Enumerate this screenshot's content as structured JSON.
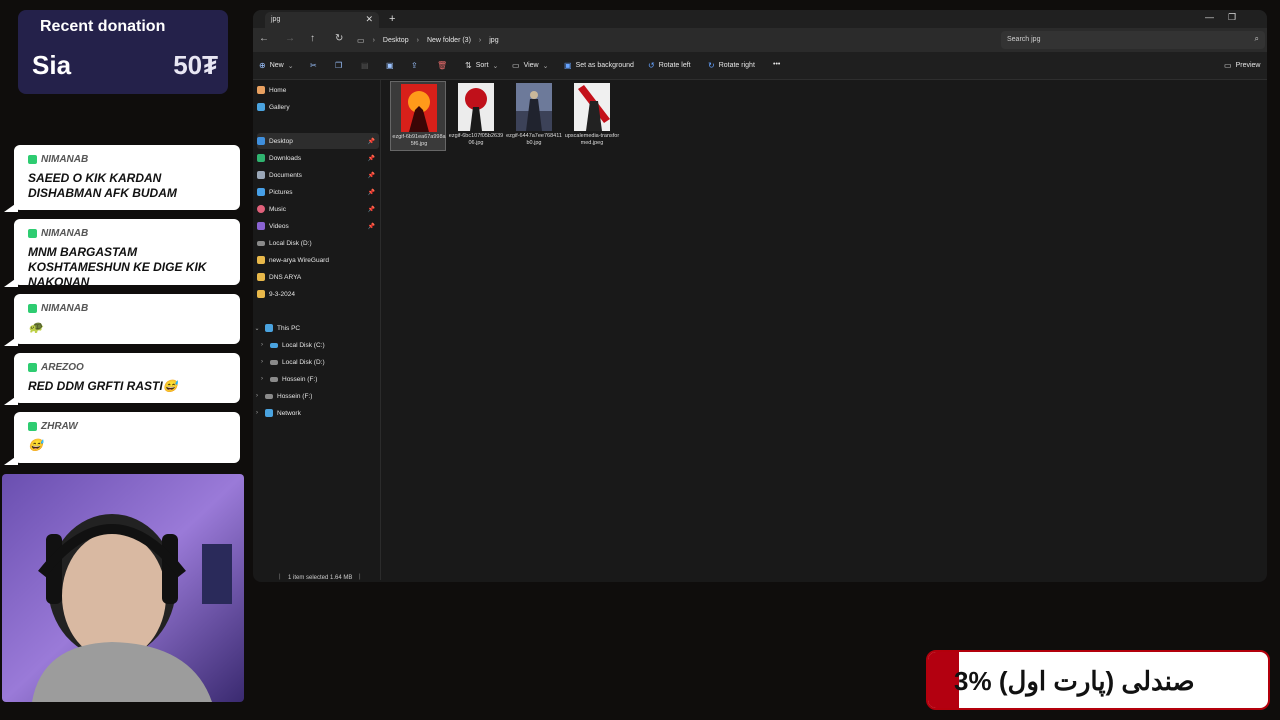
{
  "overlay": {
    "donation": {
      "title": "Recent donation",
      "name": "Sia",
      "amount": "50₮"
    },
    "chat": [
      {
        "user": "NIMANAB",
        "message": "SAEED O KIK KARDAN DISHABMAN AFK BUDAM"
      },
      {
        "user": "NIMANAB",
        "message": "MNM BARGASTAM KOSHTAMESHUN KE DIGE KIK NAKONAN"
      },
      {
        "user": "NIMANAB",
        "message": "🐢"
      },
      {
        "user": "AREZOO",
        "message": "RED DDM GRFTI RASTI😅"
      },
      {
        "user": "ZHRAW",
        "message": "😅"
      }
    ],
    "banner": {
      "progress": 0.09,
      "text": "3%  صندلی (پارت اول)",
      "bar_color": "#b30010"
    }
  },
  "explorer": {
    "tab_title": "jpg",
    "breadcrumb": [
      "Desktop",
      "New folder (3)",
      "jpg"
    ],
    "search_placeholder": "Search jpg",
    "toolbar": {
      "new": "New",
      "sort": "Sort",
      "view": "View",
      "set_background": "Set as background",
      "rotate_left": "Rotate left",
      "rotate_right": "Rotate right",
      "more": "•••",
      "preview": "Preview"
    },
    "sidebar": {
      "quick": [
        {
          "label": "Home",
          "icon": "home-icon",
          "color": "#e8a060"
        },
        {
          "label": "Gallery",
          "icon": "gallery-icon",
          "color": "#4aa3df"
        }
      ],
      "pinned": [
        {
          "label": "Desktop",
          "icon": "desktop-icon",
          "color": "#3f8fdd",
          "selected": true
        },
        {
          "label": "Downloads",
          "icon": "downloads-icon",
          "color": "#2fb36f"
        },
        {
          "label": "Documents",
          "icon": "documents-icon",
          "color": "#9aa7b8"
        },
        {
          "label": "Pictures",
          "icon": "pictures-icon",
          "color": "#47a0e8"
        },
        {
          "label": "Music",
          "icon": "music-icon",
          "color": "#e0607a"
        },
        {
          "label": "Videos",
          "icon": "videos-icon",
          "color": "#8a63d2"
        },
        {
          "label": "Local Disk (D:)",
          "icon": "drive-icon",
          "color": "#8a8a8a"
        },
        {
          "label": "new-arya WireGuard",
          "icon": "folder-icon",
          "color": "#e8b84a"
        },
        {
          "label": "DNS ARYA",
          "icon": "folder-icon",
          "color": "#e8b84a"
        },
        {
          "label": "9-3-2024",
          "icon": "folder-icon",
          "color": "#e8b84a"
        }
      ],
      "this_pc": "This PC",
      "drives": [
        {
          "label": "Local Disk (C:)",
          "icon": "drive-icon",
          "color": "#4aa3df"
        },
        {
          "label": "Local Disk (D:)",
          "icon": "drive-icon",
          "color": "#8a8a8a"
        },
        {
          "label": "Hossein (F:)",
          "icon": "drive-icon",
          "color": "#8a8a8a"
        }
      ],
      "other": [
        {
          "label": "Hossein (F:)",
          "icon": "drive-icon",
          "color": "#8a8a8a"
        },
        {
          "label": "Network",
          "icon": "network-icon",
          "color": "#4aa3df"
        }
      ]
    },
    "files": [
      {
        "name": "ezgif-6b91ea67a998a5f6.jpg",
        "selected": true
      },
      {
        "name": "ezgif-6bc107f05b263906.jpg",
        "selected": false
      },
      {
        "name": "ezgif-6447a7ee768411b0.jpg",
        "selected": false
      },
      {
        "name": "upscalemedia-transformed.jpeg",
        "selected": false
      }
    ],
    "status": "1 item selected  1.64 MB"
  }
}
